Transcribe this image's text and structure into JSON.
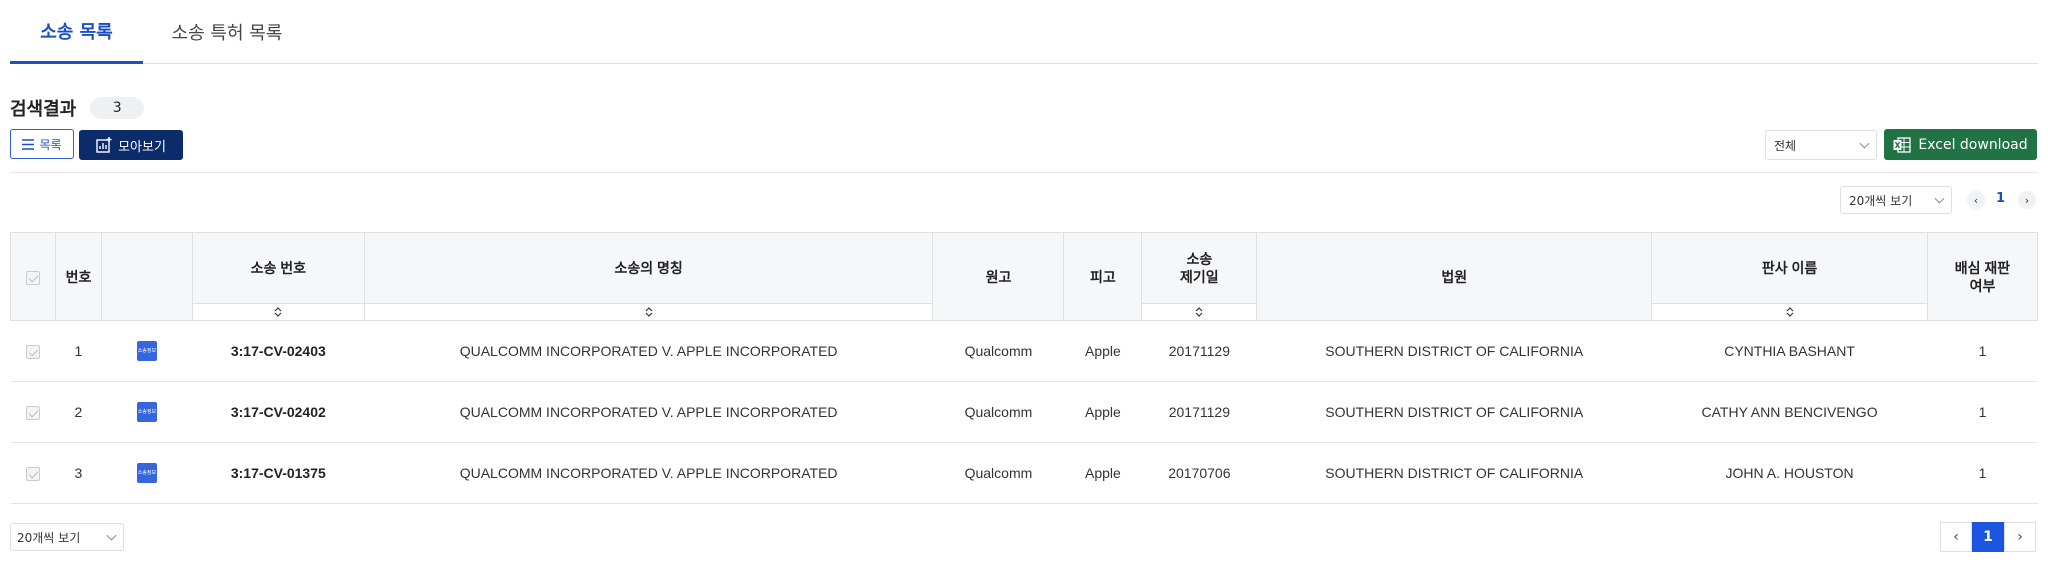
{
  "tabs": [
    {
      "label": "소송 목록",
      "active": true
    },
    {
      "label": "소송 특허 목록",
      "active": false
    }
  ],
  "result": {
    "label": "검색결과",
    "count": "3"
  },
  "toolbar": {
    "list_label": "목록",
    "gallery_label": "모아보기",
    "filter_selected": "전체",
    "excel_label": "Excel download"
  },
  "pagination_top": {
    "per_page": "20개씩 보기",
    "current_page": "1"
  },
  "table": {
    "headers": {
      "no": "번호",
      "case_no": "소송 번호",
      "case_name": "소송의 명칭",
      "plaintiff": "원고",
      "defendant": "피고",
      "filed_date": "소송\n제기일",
      "court": "법원",
      "judge": "판사 이름",
      "jury": "배심 재판\n여부"
    },
    "icon_label": "소송정보",
    "rows": [
      {
        "no": "1",
        "case_no": "3:17-CV-02403",
        "case_name": "QUALCOMM INCORPORATED V. APPLE INCORPORATED",
        "plaintiff": "Qualcomm",
        "defendant": "Apple",
        "filed_date": "20171129",
        "court": "SOUTHERN DISTRICT OF CALIFORNIA",
        "judge": "CYNTHIA BASHANT",
        "jury": "1"
      },
      {
        "no": "2",
        "case_no": "3:17-CV-02402",
        "case_name": "QUALCOMM INCORPORATED V. APPLE INCORPORATED",
        "plaintiff": "Qualcomm",
        "defendant": "Apple",
        "filed_date": "20171129",
        "court": "SOUTHERN DISTRICT OF CALIFORNIA",
        "judge": "CATHY ANN BENCIVENGO",
        "jury": "1"
      },
      {
        "no": "3",
        "case_no": "3:17-CV-01375",
        "case_name": "QUALCOMM INCORPORATED V. APPLE INCORPORATED",
        "plaintiff": "Qualcomm",
        "defendant": "Apple",
        "filed_date": "20170706",
        "court": "SOUTHERN DISTRICT OF CALIFORNIA",
        "judge": "JOHN A. HOUSTON",
        "jury": "1"
      }
    ]
  },
  "pagination_bottom": {
    "per_page": "20개씩 보기",
    "current_page": "1"
  },
  "colors": {
    "accent": "#1c4fc4",
    "navy": "#0b2b6b",
    "excel": "#217346",
    "active_page": "#1c55e0"
  }
}
